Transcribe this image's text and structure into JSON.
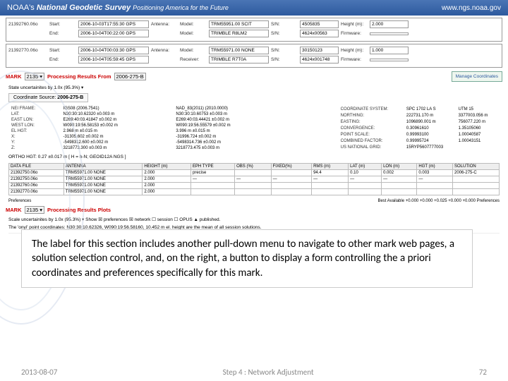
{
  "banner": {
    "org": "NOAA's",
    "title": "National Geodetic Survey",
    "tagline": "Positioning America for the Future",
    "url": "www.ngs.noaa.gov"
  },
  "files": [
    {
      "name": "21392760.06o",
      "start_l": "Start:",
      "start": "2006-10-03T17:55:30 GPS",
      "end_l": "End:",
      "end": "2006-10-04T00:22:00 GPS",
      "c3l": "Antenna:",
      "c3a": "Model:",
      "c3av": "TRM55951.00  SCIT",
      "c3b": "Model:",
      "c3bv": "TRIMBLE  R8LM2",
      "c4l": "S/N:",
      "c4v1": "4505835",
      "c4v2": "4624x00563",
      "c5l": "Height (m):",
      "c5v1": "2.000",
      "c5l2": "Firmware:",
      "c5v2": ""
    },
    {
      "name": "21392770.06o",
      "start_l": "Start:",
      "start": "2006-10-04T00:03:30 GPS",
      "end_l": "End:",
      "end": "2006-10-04T05:59:45 GPS",
      "c3l": "Antenna:",
      "c3a": "Model:",
      "c3av": "TRM55971.00  NONE",
      "c3b": "Receiver:",
      "c3bv": "TRIMBLE  R7T0A",
      "c4l": "S/N:",
      "c4v1": "30150123",
      "c4v2": "4624x001748",
      "c5l": "Height (m):",
      "c5v1": "1.000",
      "c5l2": "Firmware:",
      "c5v2": ""
    }
  ],
  "markhdr": {
    "mark": "MARK",
    "sel": "2135 ▾",
    "txt": "Processing Results From",
    "proj": "2006-275-B",
    "btn": "Manage Coordinates"
  },
  "scale": "State uncertainites by 1.0x (95.3%) ▾",
  "coord_src_l": "Coordinate Source:",
  "coord_src": "2006-275-B",
  "tri": {
    "r": [
      [
        "NEI FRAME:",
        "IGS08 (2006.7541)"
      ],
      [
        "LAT:",
        "N30:30:10.62320 ±0.003 m"
      ],
      [
        "EAST LON:",
        "E269:40:03.41847 ±0.002 m"
      ],
      [
        "WEST LON:",
        "W090:19:56.58153 ±0.002 m"
      ],
      [
        "EL HGT:",
        "2.968 m ±0.015 m"
      ],
      [
        "X:",
        "-31305.602 ±0.002 m"
      ],
      [
        "Y:",
        "-5498312.600 ±0.002 m"
      ],
      [
        "Z:",
        "3218773.300 ±0.003 m"
      ]
    ],
    "m": [
      [
        "NAD_83(2011) (2010.0000)",
        ""
      ],
      [
        "N30:30:10.60753 ±0.003 m",
        ""
      ],
      [
        "E269:40:03.44421 ±0.002 m",
        ""
      ],
      [
        "W090:19:56.55579 ±0.002 m",
        ""
      ],
      [
        "3.996 m ±0.015 m",
        ""
      ],
      [
        "-31996.724 ±0.002 m",
        ""
      ],
      [
        "-5498314.736 ±0.002 m",
        ""
      ],
      [
        "3218773.475 ±0.003 m",
        ""
      ]
    ],
    "rgt": [
      [
        "COORDINATE SYSTEM:",
        "SPC 1702 LA S",
        "UTM 15"
      ],
      [
        "NORTHING:",
        "222731.170 m",
        "3377003.056 m"
      ],
      [
        "EASTING:",
        "1096890.001 m",
        "756077.220 m"
      ],
      [
        "CONVERGENCE:",
        "0.30961610",
        "1.35105060"
      ],
      [
        "POINT SCALE:",
        "0.99993100",
        "1.00040587"
      ],
      [
        "COMBINED FACTOR:",
        "0.99995724",
        "1.00043151"
      ],
      [
        "US NATIONAL GRID:",
        "15RYP5607777003",
        ""
      ]
    ],
    "ortho": "ORTHO HGT: 0.27 ±0.017 m [ H = h-N; GEOID12A NGS ]"
  },
  "dt": {
    "hdr": [
      "DATA FILE",
      "ANTENNA",
      "HEIGHT (m)",
      "EPH TYPE",
      "OBS (%)",
      "FIXED(%)",
      "RMS (m)",
      "LAT (m)",
      "LON (m)",
      "HGT (m)",
      "SOLUTION"
    ],
    "rows": [
      [
        "21392750.06o",
        "TRM55971.00  NONE",
        "2.000",
        "precise",
        "",
        "",
        "94.4",
        "0.10",
        "0.002",
        "0.003",
        "2006-275-C"
      ],
      [
        "21392750.06o",
        "TRM55971.00  NONE",
        "2.000",
        "—",
        "—",
        "—",
        "—",
        "—",
        "—",
        "—",
        ""
      ],
      [
        "21392760.06o",
        "TRM55971.00  NONE",
        "2.000",
        "",
        "",
        "",
        "",
        "",
        "",
        "",
        ""
      ],
      [
        "21392770.06o",
        "TRM55971.00  NONE",
        "2.000",
        "",
        "",
        "",
        "",
        "",
        "",
        "",
        ""
      ]
    ]
  },
  "prefs": {
    "l": "Preferences",
    "r": "Best Available    +0.000   +0.000   +0.025   +0.000   +0.000    Preferences"
  },
  "plots": {
    "mark": "MARK",
    "sel": "2135 ▾",
    "txt": "Processing Results Plots",
    "scale": "Scale uncertainites by 1.0x (95.3%) ▾   Show ☒ preferences ☒ network ☐ session ☐ OPUS ▲ published.",
    "note": "The 'onyi' point coordinates: N30:30:10.62326, W090:19:56.58160, 10.452 m el. height are the mean of all session solutions."
  },
  "callout": "The label for this section includes another pull-down menu to navigate to other mark web pages, a solution selection control, and, on the right, a button to display a form controlling the a priori coordinates and preferences specifically for this mark.",
  "footer": {
    "date": "2013-08-07",
    "mid": "Step 4 : Network Adjustment",
    "pg": "72"
  }
}
